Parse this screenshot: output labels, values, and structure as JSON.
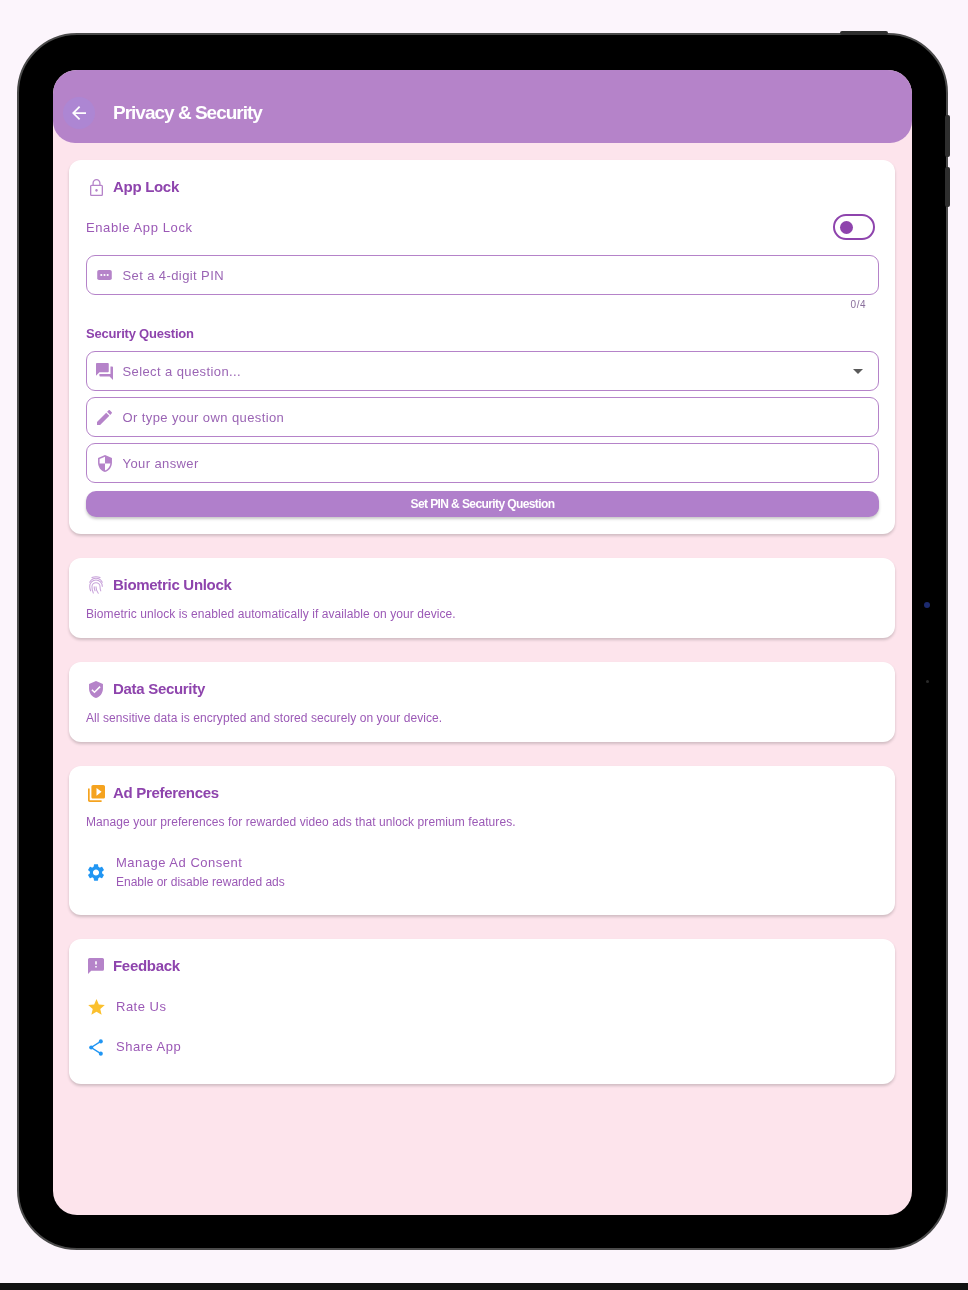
{
  "app_bar": {
    "title": "Privacy & Security"
  },
  "sections": [
    {
      "kind": "applock",
      "title": "App Lock",
      "toggle": {
        "label": "Enable App Lock",
        "on": false
      },
      "pin_field": {
        "placeholder": "Set a 4-digit PIN",
        "counter": "0/4"
      },
      "question_heading": "Security Question",
      "question_select": {
        "placeholder": "Select a question..."
      },
      "custom_question_field": {
        "placeholder": "Or type your own question"
      },
      "answer_field": {
        "placeholder": "Your answer"
      },
      "submit_button": {
        "label": "Set PIN & Security Question"
      }
    },
    {
      "kind": "biometric",
      "title": "Biometric Unlock",
      "description": "Biometric unlock is enabled automatically if available on your device."
    },
    {
      "kind": "datasecurity",
      "title": "Data Security",
      "description": "All sensitive data is encrypted and stored securely on your device."
    },
    {
      "kind": "ads",
      "title": "Ad Preferences",
      "description": "Manage your preferences for rewarded video ads that unlock premium features.",
      "items": [
        {
          "kind": "consent",
          "title": "Manage Ad Consent",
          "subtitle": "Enable or disable rewarded ads"
        }
      ]
    },
    {
      "kind": "feedback",
      "title": "Feedback",
      "items": [
        {
          "kind": "rate",
          "title": "Rate Us"
        },
        {
          "kind": "share",
          "title": "Share App"
        }
      ]
    }
  ]
}
